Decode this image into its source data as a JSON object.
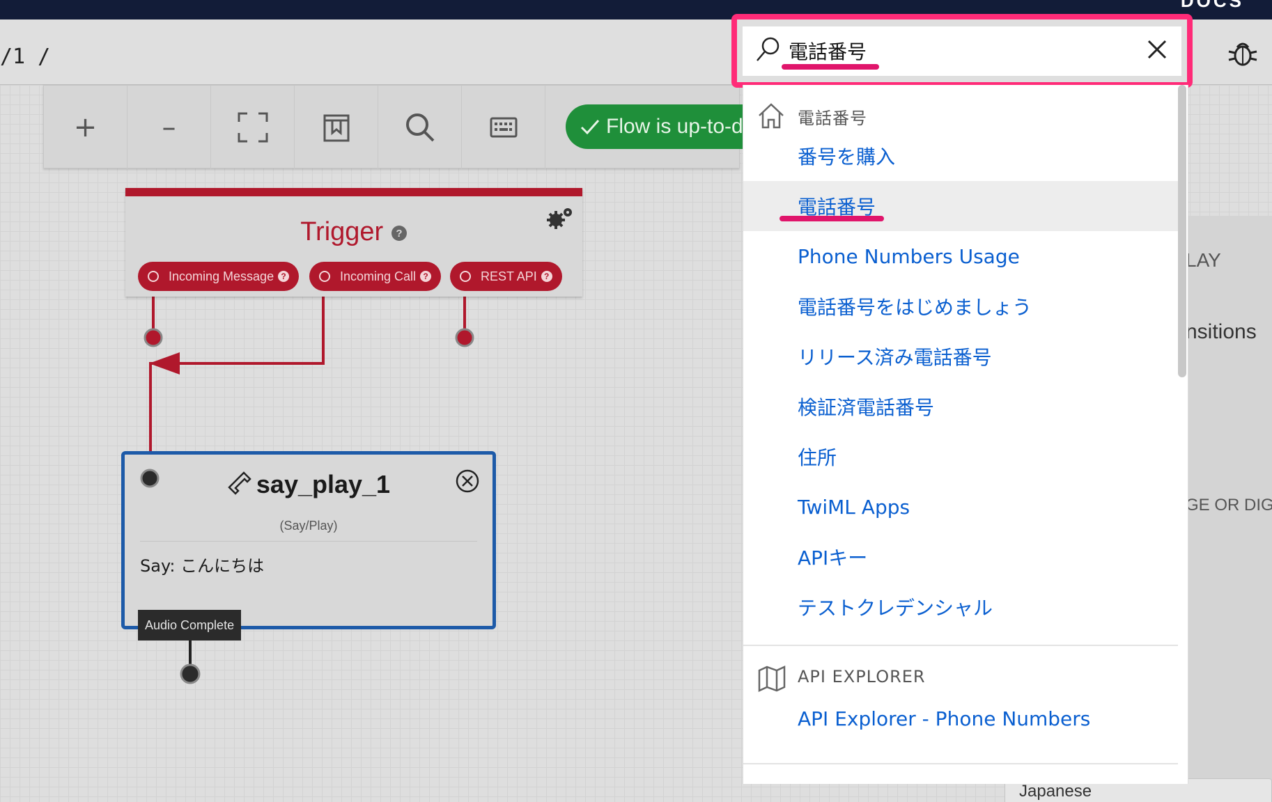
{
  "topbar": {
    "docs_label": "DOCS"
  },
  "breadcrumb": "/1 /",
  "toolbar": {
    "zoom_in": "+",
    "zoom_out": "–",
    "flow_status": "Flow is up-to-d"
  },
  "trigger": {
    "title": "Trigger",
    "pills": [
      "Incoming Message",
      "Incoming Call",
      "REST API"
    ]
  },
  "say_widget": {
    "title": "say_play_1",
    "type": "(Say/Play)",
    "body": "Say: こんにちは",
    "output": "Audio Complete"
  },
  "search": {
    "query": "電話番号",
    "groups": [
      {
        "heading": "電話番号",
        "icon": "home-icon",
        "items": [
          "番号を購入",
          "電話番号",
          "Phone Numbers Usage",
          "電話番号をはじめましょう",
          "リリース済み電話番号",
          "検証済電話番号",
          "住所",
          "TwiML Apps",
          "APIキー",
          "テストクレデンシャル"
        ]
      },
      {
        "heading": "API EXPLORER",
        "icon": "map-icon",
        "items": [
          "API Explorer - Phone Numbers"
        ]
      }
    ],
    "active_item": "電話番号"
  },
  "right_panel": {
    "fragments": [
      "LAY",
      "nsitions",
      "GE OR DIG",
      "Japanese"
    ]
  },
  "colors": {
    "trigger_red": "#b0182c",
    "widget_blue": "#1d5aa8",
    "link_blue": "#0a5fd0",
    "highlight_pink": "#ff2b78",
    "status_green": "#1f8f3a"
  }
}
